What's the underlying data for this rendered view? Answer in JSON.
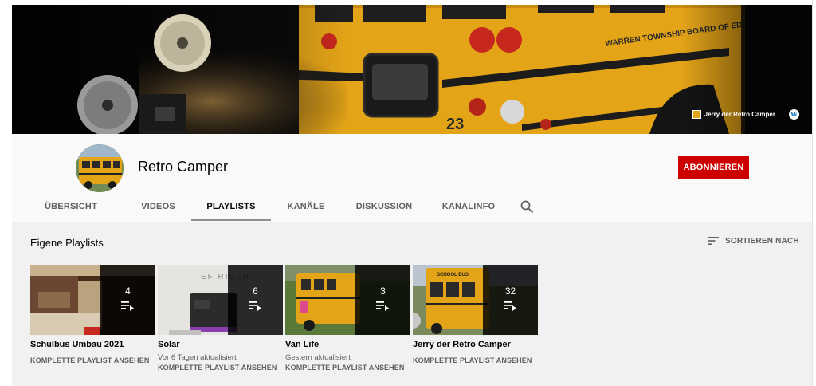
{
  "banner": {
    "bus_text": "WARREN TOWNSHIP BOARD OF EDUCATION",
    "bus_number": "23",
    "link_name": "Jerry der Retro Camper"
  },
  "channel": {
    "name": "Retro Camper",
    "subscribe_label": "ABONNIEREN"
  },
  "tabs": [
    {
      "label": "ÜBERSICHT",
      "active": false
    },
    {
      "label": "VIDEOS",
      "active": false
    },
    {
      "label": "PLAYLISTS",
      "active": true
    },
    {
      "label": "KANÄLE",
      "active": false
    },
    {
      "label": "DISKUSSION",
      "active": false
    },
    {
      "label": "KANALINFO",
      "active": false
    }
  ],
  "section": {
    "title": "Eigene Playlists",
    "sort_label": "SORTIEREN NACH"
  },
  "playlists": [
    {
      "title": "Schulbus Umbau 2021",
      "count": "4",
      "updated": "",
      "link": "KOMPLETTE PLAYLIST ANSEHEN"
    },
    {
      "title": "Solar",
      "count": "6",
      "updated": "Vor 6 Tagen aktualisiert",
      "link": "KOMPLETTE PLAYLIST ANSEHEN",
      "thumb_text": "EF RIVER"
    },
    {
      "title": "Van Life",
      "count": "3",
      "updated": "Gestern aktualisiert",
      "link": "KOMPLETTE PLAYLIST ANSEHEN"
    },
    {
      "title": "Jerry der Retro Camper",
      "count": "32",
      "updated": "",
      "link": "KOMPLETTE PLAYLIST ANSEHEN",
      "thumb_text": "SCHOOL BUS"
    }
  ],
  "colors": {
    "subscribe": "#cc0000",
    "bus_yellow": "#e8a919",
    "header_bg": "#f9f9f9",
    "content_bg": "#f1f1f1"
  }
}
